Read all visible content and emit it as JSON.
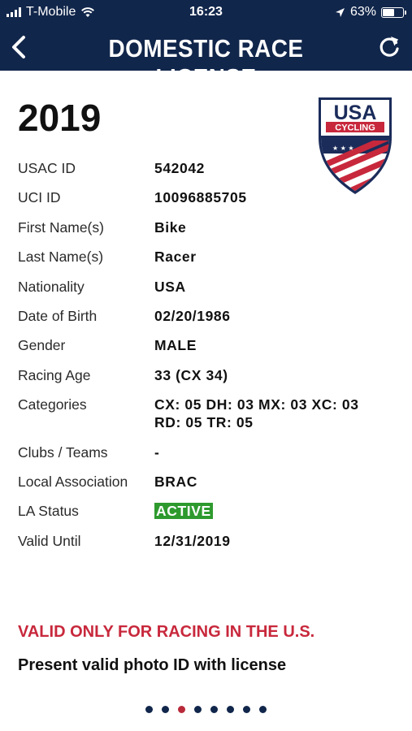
{
  "status_bar": {
    "carrier": "T-Mobile",
    "time": "16:23",
    "battery": "63%",
    "battery_level": 0.63
  },
  "header": {
    "title": "DOMESTIC RACE LICENSE",
    "back_icon": "chevron-left-icon",
    "refresh_icon": "refresh-icon",
    "bg_color": "#11264b"
  },
  "license": {
    "year": "2019",
    "logo_text_top": "USA",
    "logo_text_bottom": "CYCLING",
    "rows": [
      {
        "label": "USAC ID",
        "value": "542042"
      },
      {
        "label": "UCI ID",
        "value": "10096885705"
      },
      {
        "label": "First Name(s)",
        "value": "Bike"
      },
      {
        "label": "Last Name(s)",
        "value": "Racer"
      },
      {
        "label": "Nationality",
        "value": "USA"
      },
      {
        "label": "Date of Birth",
        "value": "02/20/1986"
      },
      {
        "label": "Gender",
        "value": "MALE"
      },
      {
        "label": "Racing Age",
        "value": "33 (CX 34)"
      },
      {
        "label": "Categories",
        "value": "CX: 05 DH: 03 MX: 03 XC: 03",
        "value2": "RD: 05 TR: 05"
      },
      {
        "label": "Clubs / Teams",
        "value": "-"
      },
      {
        "label": "Local Association",
        "value": "BRAC"
      },
      {
        "label": "LA Status",
        "value": "ACTIVE",
        "status_color": "#2e9a2e"
      },
      {
        "label": "Valid Until",
        "value": "12/31/2019"
      }
    ]
  },
  "footer": {
    "warning": "VALID ONLY FOR RACING IN THE U.S.",
    "warning_color": "#c8283c",
    "note": "Present valid photo ID with license"
  },
  "pager": {
    "count": 8,
    "active_index": 2
  }
}
